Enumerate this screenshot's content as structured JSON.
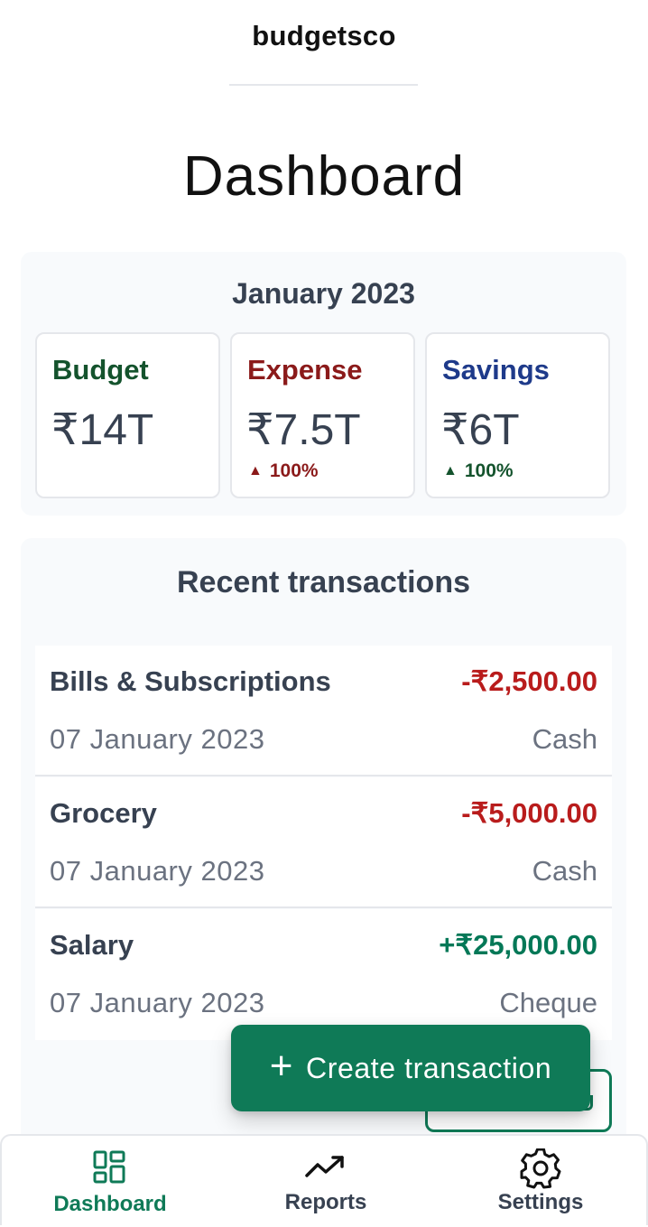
{
  "app": {
    "brand": "budgetsco"
  },
  "page": {
    "title": "Dashboard"
  },
  "summary": {
    "period": "January 2023",
    "cards": [
      {
        "label": "Budget",
        "value": "₹14T",
        "change": "",
        "color": "#14532d"
      },
      {
        "label": "Expense",
        "value": "₹7.5T",
        "change": "100%",
        "direction": "up",
        "color": "#8b1a1a",
        "change_color": "#8b1a1a"
      },
      {
        "label": "Savings",
        "value": "₹6T",
        "change": "100%",
        "direction": "up",
        "color": "#1e3a8a",
        "change_color": "#14532d"
      }
    ]
  },
  "recent": {
    "title": "Recent transactions",
    "rows": [
      {
        "category": "Bills & Subscriptions",
        "amount": "-₹2,500.00",
        "date": "07 January 2023",
        "method": "Cash",
        "type": "expense"
      },
      {
        "category": "Grocery",
        "amount": "-₹5,000.00",
        "date": "07 January 2023",
        "method": "Cash",
        "type": "expense"
      },
      {
        "category": "Salary",
        "amount": "+₹25,000.00",
        "date": "07 January 2023",
        "method": "Cheque",
        "type": "income"
      }
    ]
  },
  "fab": {
    "label": "Create transaction",
    "icon": "plus-icon"
  },
  "nav": {
    "items": [
      {
        "label": "Dashboard",
        "icon": "dashboard-grid-icon",
        "active": true
      },
      {
        "label": "Reports",
        "icon": "trending-up-icon",
        "active": false
      },
      {
        "label": "Settings",
        "icon": "gear-icon",
        "active": false
      }
    ]
  },
  "colors": {
    "primary": "#0f7a57",
    "expense": "#b91c1c",
    "income": "#047857",
    "muted": "#6b7280",
    "text": "#374151",
    "panel": "#f8fafc"
  }
}
